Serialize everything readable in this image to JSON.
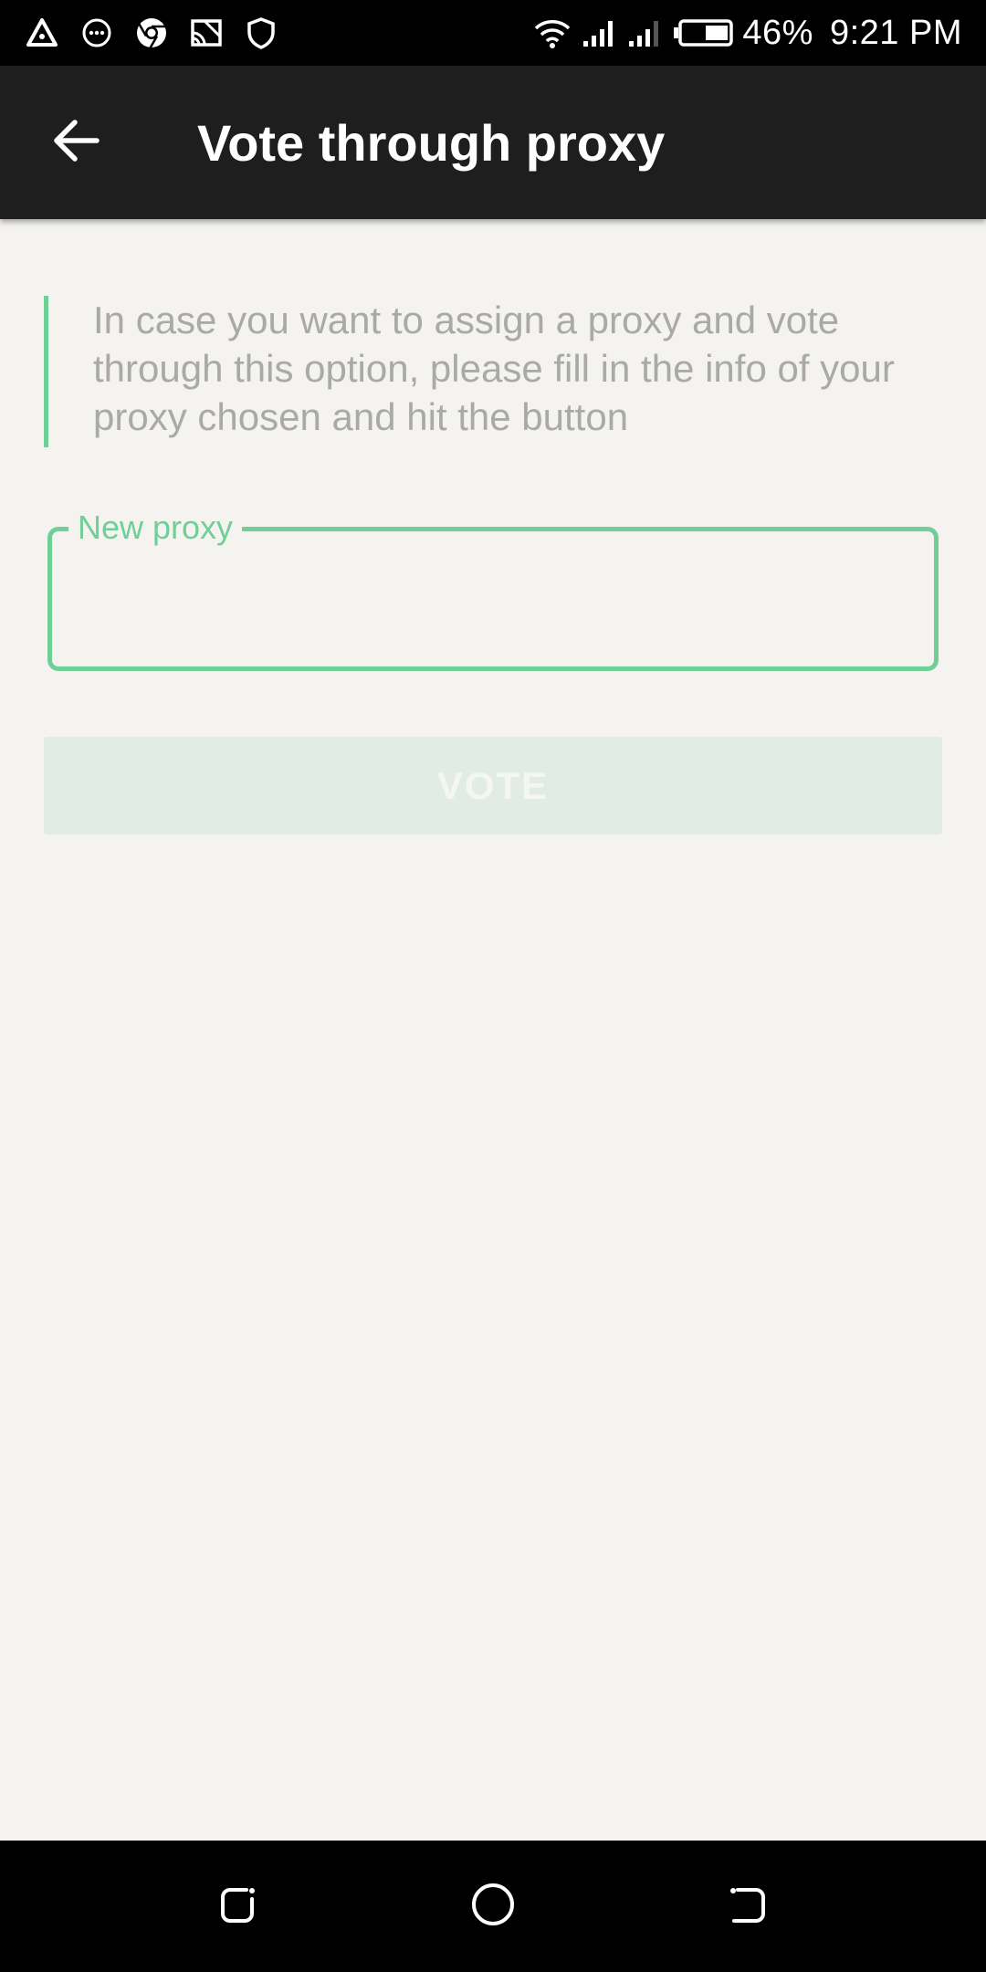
{
  "status_bar": {
    "battery": "46%",
    "time": "9:21 PM",
    "icons": [
      "delta-icon",
      "message-icon",
      "chrome-icon",
      "cast-icon",
      "shield-icon",
      "wifi-icon",
      "signal-icon",
      "signal-icon-2",
      "battery-icon"
    ]
  },
  "app_bar": {
    "title": "Vote through proxy",
    "back_icon": "arrow-left-icon"
  },
  "info": {
    "text": "In case you want to assign a proxy and vote through this option, please fill in the info of your proxy chosen and hit the button"
  },
  "proxy_field": {
    "label": "New proxy",
    "value": "",
    "placeholder": ""
  },
  "vote_button": {
    "label": "VOTE"
  },
  "nav_bar": {
    "icons": [
      "recents-icon",
      "home-icon",
      "back-icon"
    ]
  },
  "colors": {
    "accent": "#6fcf97",
    "app_bar": "#1e1e1e",
    "background": "#f4f3ef",
    "button_disabled": "#e1ede4"
  }
}
